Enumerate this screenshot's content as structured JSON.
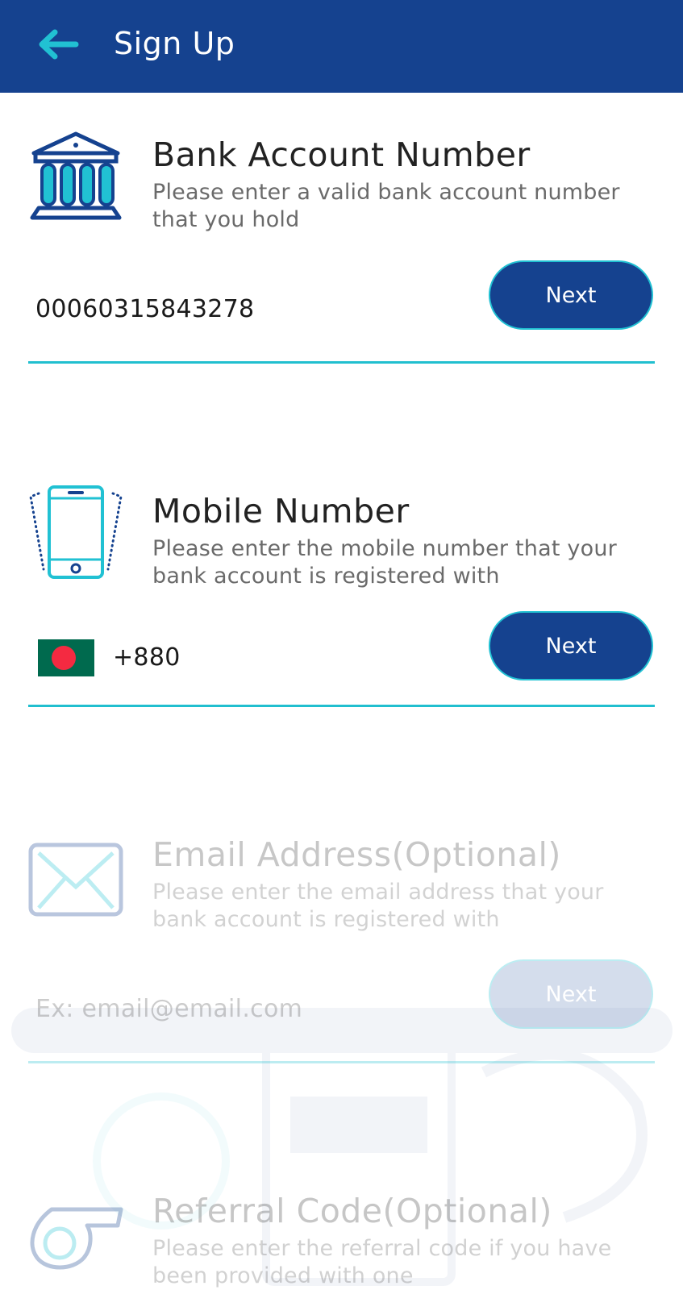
{
  "appbar": {
    "title": "Sign Up",
    "back_icon": "arrow-left-icon",
    "background": "#15428F",
    "accent": "#21C1D3"
  },
  "bank": {
    "icon": "bank-icon",
    "title": "Bank Account Number",
    "description": "Please enter a valid bank account number that you hold",
    "value": "00060315843278",
    "next_label": "Next"
  },
  "mobile": {
    "icon": "mobile-phone-icon",
    "title": "Mobile Number",
    "description": "Please enter the mobile number that your bank account is registered with",
    "flag": "bangladesh-flag-icon",
    "country_code": "+880",
    "next_label": "Next"
  },
  "email": {
    "icon": "envelope-icon",
    "title": "Email Address(Optional)",
    "description": "Please enter the email address that your bank account is registered with",
    "placeholder": "Ex: email@email.com",
    "next_label": "Next"
  },
  "referral": {
    "icon": "whistle-icon",
    "title": "Referral Code(Optional)",
    "description": "Please enter the referral code if you have been provided with one"
  }
}
